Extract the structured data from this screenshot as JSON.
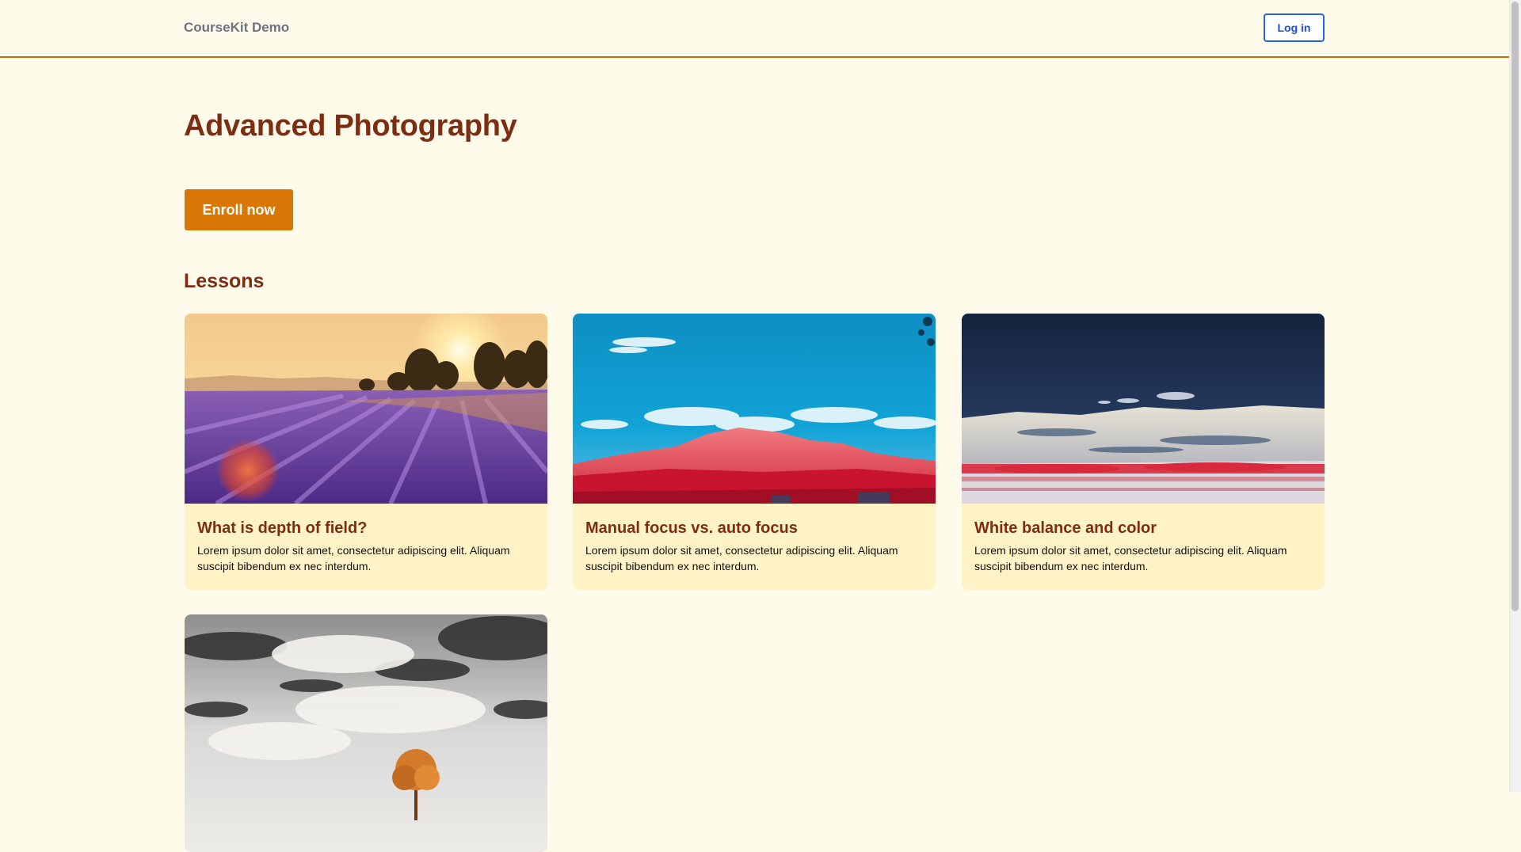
{
  "header": {
    "brand": "CourseKit Demo",
    "login_label": "Log in"
  },
  "course": {
    "title": "Advanced Photography",
    "enroll_label": "Enroll now"
  },
  "lessons_section": {
    "title": "Lessons",
    "items": [
      {
        "title": "What is depth of field?",
        "description": "Lorem ipsum dolor sit amet, consectetur adipiscing elit. Aliquam suscipit bibendum ex nec interdum.",
        "image": "lavender-field-sunset"
      },
      {
        "title": "Manual focus vs. auto focus",
        "description": "Lorem ipsum dolor sit amet, consectetur adipiscing elit. Aliquam suscipit bibendum ex nec interdum.",
        "image": "red-mountain-blue-sky"
      },
      {
        "title": "White balance and color",
        "description": "Lorem ipsum dolor sit amet, consectetur adipiscing elit. Aliquam suscipit bibendum ex nec interdum.",
        "image": "clouds-over-red-meadow"
      },
      {
        "image": "lone-orange-tree-under-clouds"
      }
    ]
  },
  "colors": {
    "page_background": "#fffbeb",
    "accent": "#d97706",
    "heading": "#7c2d12",
    "card_background": "#fef3c7",
    "login_border": "#2563eb"
  }
}
